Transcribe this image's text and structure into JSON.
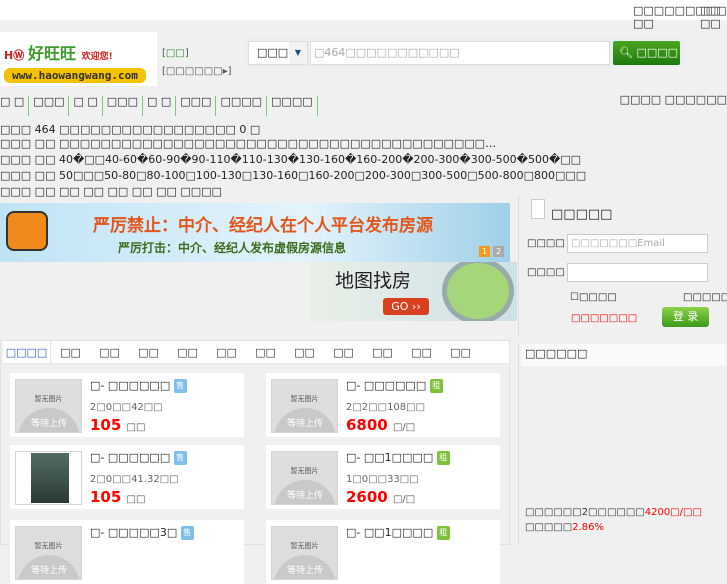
{
  "topbar": {
    "welcome": "□□□□□□□□□ □□",
    "links": "□□ □□"
  },
  "logo": {
    "cn": "好旺旺",
    "slogan": "欢迎您!",
    "url": "www.haowangwang.com"
  },
  "header_links": {
    "city": "□□",
    "switch": "□□□□□□▸"
  },
  "search": {
    "type": "□□□",
    "type_arrow": "▼",
    "placeholder": "□464□□□□□□□□□□□",
    "button": "□□□□"
  },
  "nav": {
    "items": [
      "□ □",
      "□□□",
      "□ □",
      "□□□",
      "□ □",
      "□□□",
      "□□□□",
      "□□□□"
    ],
    "right": "□□□□ □□□□□□"
  },
  "filters": [
    "□□□ 464 □□□□□□□□□□□□□□□□□ 0 □",
    "□□□ □□ □□□□□□□□□□□□□□□□□□□□□□□□□□□□□□□□□□□□□□□□□…",
    "□□□ □□ 40�□□40-60�60-90�90-110�110-130�130-160�160-200�200-300�300-500�500�□□",
    "□□□ □□ 50□□□50-80□80-100□100-130□130-160□160-200□200-300□300-500□500-800□800□□□",
    "□□□ □□ □□ □□ □□ □□ □□ □□□□",
    "□□□□□□>>"
  ],
  "banner": {
    "line1": "严厉禁止：中介、经纪人在个人平台发布房源",
    "line2": "严厉打击：中介、经纪人发布虚假房源信息",
    "pages": [
      "1",
      "2"
    ]
  },
  "map_banner": {
    "title": "地图找房",
    "go": "GO ››"
  },
  "login": {
    "title": "□□□□□",
    "user_label": "□□□□",
    "user_placeholder": "□□□□□□□Email",
    "pass_label": "□□□□",
    "remember": "□□□□",
    "forgot": "□□□□□",
    "register": "□□□□□□□",
    "submit": "登 录"
  },
  "tabs": [
    "□□□□",
    "□□",
    "□□",
    "□□",
    "□□",
    "□□",
    "□□",
    "□□",
    "□□",
    "□□",
    "□□",
    "□□"
  ],
  "placeholder_image": {
    "top": "暂无图片",
    "bottom": "等待上传"
  },
  "listings": [
    {
      "title": "□- □□□□□□",
      "tag": "售",
      "meta": "2□0□□42□□",
      "price": "105",
      "unit": "□□",
      "photo": false
    },
    {
      "title": "□- □□□□□□",
      "tag": "租",
      "meta": "2□2□□108□□",
      "price": "6800",
      "unit": "□/□",
      "photo": false
    },
    {
      "title": "□- □□□□□□",
      "tag": "售",
      "meta": "2□0□□41.32□□",
      "price": "105",
      "unit": "□□",
      "photo": true
    },
    {
      "title": "□- □□1□□□□",
      "tag": "租",
      "meta": "1□0□□33□□",
      "price": "2600",
      "unit": "□/□",
      "photo": false
    },
    {
      "title": "□- □□□□□3□",
      "tag": "售",
      "meta": "",
      "price": "",
      "unit": "",
      "photo": false
    },
    {
      "title": "□- □□1□□□□",
      "tag": "租",
      "meta": "",
      "price": "",
      "unit": "",
      "photo": false
    }
  ],
  "side": {
    "title": "□□□□□□",
    "avg_label": "□□□□□□2□□□□□□",
    "avg_value": "4200□/□□",
    "rate_label": "□□□□□",
    "rate_value": "2.86%"
  }
}
